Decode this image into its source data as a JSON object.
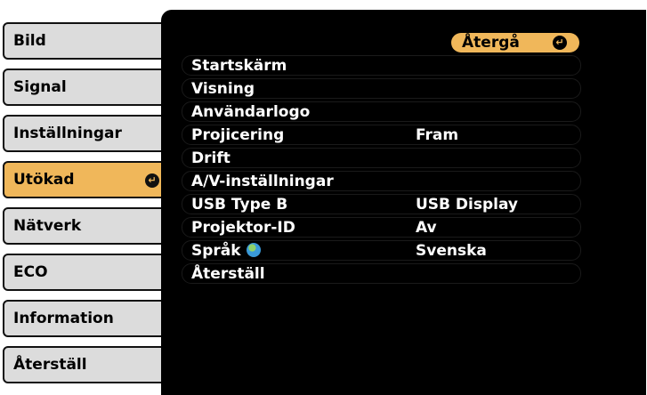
{
  "tabs": [
    {
      "label": "Bild"
    },
    {
      "label": "Signal"
    },
    {
      "label": "Inställningar"
    },
    {
      "label": "Utökad"
    },
    {
      "label": "Nätverk"
    },
    {
      "label": "ECO"
    },
    {
      "label": "Information"
    },
    {
      "label": "Återställ"
    }
  ],
  "back_button": {
    "label": "Återgå"
  },
  "menu_items": [
    {
      "label": "Startskärm",
      "value": ""
    },
    {
      "label": "Visning",
      "value": ""
    },
    {
      "label": "Användarlogo",
      "value": ""
    },
    {
      "label": "Projicering",
      "value": "Fram"
    },
    {
      "label": "Drift",
      "value": ""
    },
    {
      "label": "A/V-inställningar",
      "value": ""
    },
    {
      "label": "USB Type B",
      "value": "USB Display"
    },
    {
      "label": "Projektor-ID",
      "value": "Av"
    },
    {
      "label": "Språk",
      "value": "Svenska"
    },
    {
      "label": "Återställ",
      "value": ""
    }
  ],
  "icons": {
    "enter": "enter-icon",
    "language": "globe-icon"
  },
  "colors": {
    "accent": "#f0b75a",
    "tab_bg": "#dcdcdc",
    "panel_bg": "#000000"
  }
}
